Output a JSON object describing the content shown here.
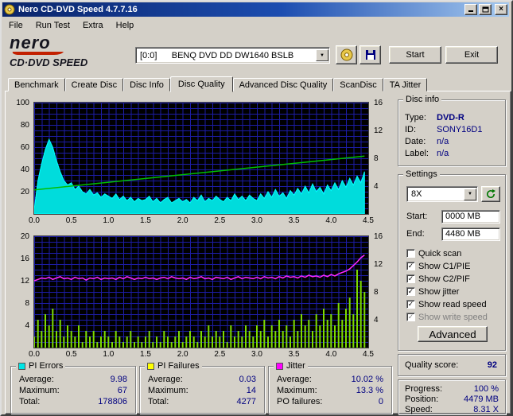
{
  "window": {
    "title": "Nero CD-DVD Speed 4.7.7.16"
  },
  "menu": [
    "File",
    "Run Test",
    "Extra",
    "Help"
  ],
  "branding": {
    "line1": "nero",
    "line2": "CD·DVD SPEED"
  },
  "toolbar": {
    "drive_combo": "[0:0]      BENQ DVD DD DW1640 BSLB",
    "start": "Start",
    "exit": "Exit"
  },
  "tabs": {
    "items": [
      "Benchmark",
      "Create Disc",
      "Disc Info",
      "Disc Quality",
      "Advanced Disc Quality",
      "ScanDisc",
      "TA Jitter"
    ],
    "active": "Disc Quality"
  },
  "disc_info": {
    "title": "Disc info",
    "rows": [
      {
        "label": "Type:",
        "value": "DVD-R",
        "bold": true
      },
      {
        "label": "ID:",
        "value": "SONY16D1",
        "bold": false
      },
      {
        "label": "Date:",
        "value": "n/a",
        "bold": false
      },
      {
        "label": "Label:",
        "value": "n/a",
        "bold": false
      }
    ]
  },
  "settings": {
    "title": "Settings",
    "speed": "8X",
    "start_label": "Start:",
    "start_value": "0000 MB",
    "end_label": "End:",
    "end_value": "4480 MB",
    "checkboxes": [
      {
        "label": "Quick scan",
        "checked": false,
        "disabled": false
      },
      {
        "label": "Show C1/PIE",
        "checked": true,
        "disabled": false
      },
      {
        "label": "Show C2/PIF",
        "checked": true,
        "disabled": false
      },
      {
        "label": "Show jitter",
        "checked": true,
        "disabled": false
      },
      {
        "label": "Show read speed",
        "checked": true,
        "disabled": false
      },
      {
        "label": "Show write speed",
        "checked": true,
        "disabled": true
      }
    ],
    "advanced": "Advanced"
  },
  "quality": {
    "label": "Quality score:",
    "value": "92"
  },
  "progress": {
    "rows": [
      {
        "label": "Progress:",
        "value": "100 %"
      },
      {
        "label": "Position:",
        "value": "4479 MB"
      },
      {
        "label": "Speed:",
        "value": "8.31 X"
      }
    ]
  },
  "legend_stats": {
    "pi_errors": {
      "title": "PI Errors",
      "color": "#00e5e5",
      "rows": [
        {
          "label": "Average:",
          "value": "9.98"
        },
        {
          "label": "Maximum:",
          "value": "67"
        },
        {
          "label": "Total:",
          "value": "178806"
        }
      ]
    },
    "pi_failures": {
      "title": "PI Failures",
      "color": "#ffff00",
      "rows": [
        {
          "label": "Average:",
          "value": "0.03"
        },
        {
          "label": "Maximum:",
          "value": "14"
        },
        {
          "label": "Total:",
          "value": "4277"
        }
      ]
    },
    "jitter": {
      "title": "Jitter",
      "color": "#ff00ff",
      "rows": [
        {
          "label": "Average:",
          "value": "10.02 %"
        },
        {
          "label": "Maximum:",
          "value": "13.3 %"
        },
        {
          "label": "PO failures:",
          "value": "0"
        }
      ]
    }
  },
  "chart_data": {
    "type": "area",
    "x_unit": "GB",
    "x_ticks": [
      "0.0",
      "0.5",
      "1.0",
      "1.5",
      "2.0",
      "2.5",
      "3.0",
      "3.5",
      "4.0",
      "4.5"
    ],
    "top": {
      "left_ticks": [
        "100",
        "80",
        "60",
        "40",
        "20"
      ],
      "right_ticks": [
        "16",
        "12",
        "8",
        "4"
      ],
      "left_max": 100,
      "right_max": 16,
      "pi_errors": [
        4,
        30,
        45,
        58,
        67,
        60,
        48,
        38,
        30,
        26,
        28,
        22,
        25,
        20,
        18,
        22,
        17,
        19,
        15,
        18,
        16,
        14,
        18,
        13,
        16,
        12,
        15,
        11,
        14,
        12,
        13,
        16,
        11,
        14,
        10,
        13,
        15,
        10,
        12,
        14,
        11,
        13,
        10,
        15,
        12,
        17,
        11,
        14,
        12,
        16,
        13,
        11,
        15,
        12,
        18,
        13,
        16,
        12,
        17,
        14,
        12,
        18,
        14,
        20,
        15,
        22,
        16,
        19,
        14,
        21,
        17,
        23,
        18,
        25,
        19,
        27,
        20,
        24,
        18,
        26,
        21,
        28,
        22,
        30,
        24,
        32,
        26,
        34,
        28,
        38
      ],
      "read_speed": {
        "start": 3.46,
        "end": 8.31
      }
    },
    "bottom": {
      "left_ticks": [
        "20",
        "16",
        "12",
        "8",
        "4"
      ],
      "right_ticks": [
        "16",
        "12",
        "8",
        "4"
      ],
      "left_max": 20,
      "right_max": 16,
      "pi_failures": [
        2,
        5,
        3,
        6,
        4,
        7,
        3,
        5,
        2,
        4,
        3,
        2,
        4,
        1,
        3,
        2,
        3,
        1,
        2,
        3,
        2,
        1,
        3,
        2,
        1,
        2,
        3,
        1,
        2,
        1,
        2,
        3,
        1,
        2,
        1,
        3,
        2,
        1,
        2,
        3,
        1,
        2,
        3,
        2,
        1,
        3,
        2,
        4,
        2,
        3,
        2,
        3,
        1,
        4,
        2,
        3,
        2,
        4,
        3,
        2,
        4,
        3,
        5,
        2,
        4,
        3,
        5,
        3,
        4,
        2,
        5,
        3,
        6,
        4,
        5,
        3,
        6,
        4,
        7,
        5,
        6,
        4,
        8,
        5,
        7,
        9,
        6,
        14,
        12,
        10
      ],
      "jitter": [
        9.6,
        9.8,
        10.0,
        9.9,
        10.1,
        9.8,
        10.0,
        10.2,
        9.9,
        10.0,
        9.8,
        10.1,
        9.9,
        10.0,
        9.7,
        10.0,
        9.9,
        10.1,
        9.8,
        10.0,
        9.9,
        10.0,
        9.8,
        10.1,
        9.9,
        10.2,
        10.0,
        9.8,
        10.0,
        9.9,
        10.1,
        9.9,
        10.0,
        9.8,
        10.0,
        10.1,
        9.9,
        10.2,
        10.0,
        9.9,
        10.0,
        9.8,
        10.1,
        9.9,
        10.0,
        10.2,
        9.9,
        10.0,
        9.8,
        10.1,
        10.0,
        9.9,
        10.1,
        9.8,
        10.0,
        10.2,
        9.9,
        10.1,
        10.0,
        9.9,
        10.1,
        9.9,
        10.2,
        10.0,
        10.1,
        9.9,
        10.2,
        10.0,
        10.3,
        10.1,
        10.2,
        10.0,
        10.3,
        10.1,
        10.4,
        10.2,
        10.3,
        10.1,
        10.4,
        10.2,
        10.5,
        10.3,
        10.6,
        10.8,
        11.0,
        11.3,
        11.8,
        12.3,
        12.9,
        13.3
      ]
    }
  }
}
